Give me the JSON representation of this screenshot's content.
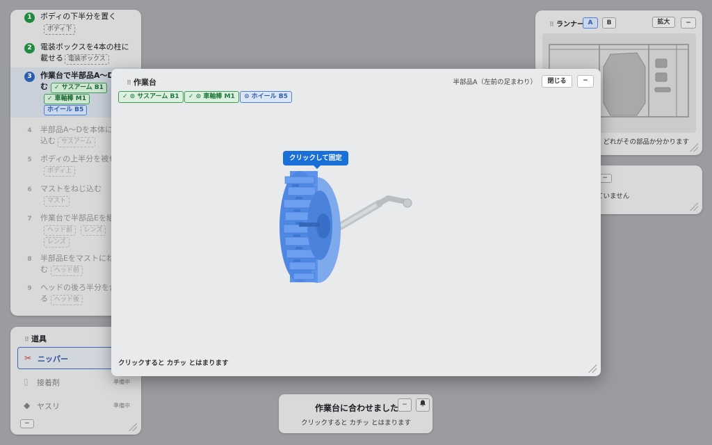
{
  "steps": [
    {
      "num": "1",
      "text": "ボディの下半分を置く",
      "tags": [
        "ボディ下"
      ],
      "state": "done"
    },
    {
      "num": "2",
      "text": "電装ボックスを4本の柱に",
      "text2": "載せる",
      "tags": [
        "電装ボックス"
      ],
      "state": "done"
    },
    {
      "num": "3",
      "text": "作業台で半部品A〜Dを",
      "text2": "む",
      "tags_ok": [
        "✓ サスアーム B1",
        "✓ 車軸棒 M1"
      ],
      "tag_sel": "ホイール B5",
      "state": "active"
    },
    {
      "num": "4",
      "text": "半部品A〜Dを本体に差し",
      "text2": "込む",
      "tags": [
        "サスアーム"
      ],
      "state": "todo"
    },
    {
      "num": "5",
      "text": "ボディの上半分を被せる",
      "tags": [
        "ボディ上"
      ],
      "state": "todo"
    },
    {
      "num": "6",
      "text": "マストをねじ込む",
      "tags": [
        "マスト"
      ],
      "state": "todo"
    },
    {
      "num": "7",
      "text": "作業台で半部品Eを組む",
      "tags": [
        "ヘッド前",
        "レンズ"
      ],
      "tags2": [
        "レンズ"
      ],
      "state": "todo"
    },
    {
      "num": "8",
      "text": "半部品Eをマストにねじ込",
      "text2": "む",
      "tags": [
        "ヘッド前"
      ],
      "state": "todo"
    },
    {
      "num": "9",
      "text": "ヘッドの後ろ半分を合わせ",
      "text2": "る",
      "tags": [
        "ヘッド後"
      ],
      "state": "todo"
    }
  ],
  "tools": {
    "title": "道具",
    "items": [
      {
        "icon": "✂",
        "label": "ニッパー",
        "status": ""
      },
      {
        "icon": "▯",
        "label": "接着剤",
        "status": "準備中"
      },
      {
        "icon": "◆",
        "label": "ヤスリ",
        "status": "準備中"
      }
    ],
    "collapse": "−"
  },
  "runner": {
    "title": "ランナー",
    "tab_a": "A",
    "tab_b": "B",
    "zoom": "拡大",
    "collapse": "−",
    "caption": "、どれがその部品か分かります"
  },
  "info": {
    "collapse": "−",
    "text": "ていません"
  },
  "toast": {
    "title": "作業台に合わせました",
    "subtitle": "クリックすると カチッ とはまります",
    "collapse": "−"
  },
  "workbench": {
    "title": "作業台",
    "part": "半部品A（左前の足まわり）",
    "close": "閉じる",
    "minimize": "−",
    "chips": [
      {
        "label": "✓ ⊙ サスアーム B1",
        "state": "ok"
      },
      {
        "label": "✓ ⊙ 車軸棒 M1",
        "state": "ok"
      },
      {
        "label": "⊙ ホイール B5",
        "state": "sel"
      }
    ],
    "tooltip": "クリックして固定",
    "footer": "クリックすると カチッ とはまります"
  },
  "colors": {
    "accent": "#1a6fd8",
    "done": "#1e8a3e",
    "wheel": "#5b93ea"
  }
}
